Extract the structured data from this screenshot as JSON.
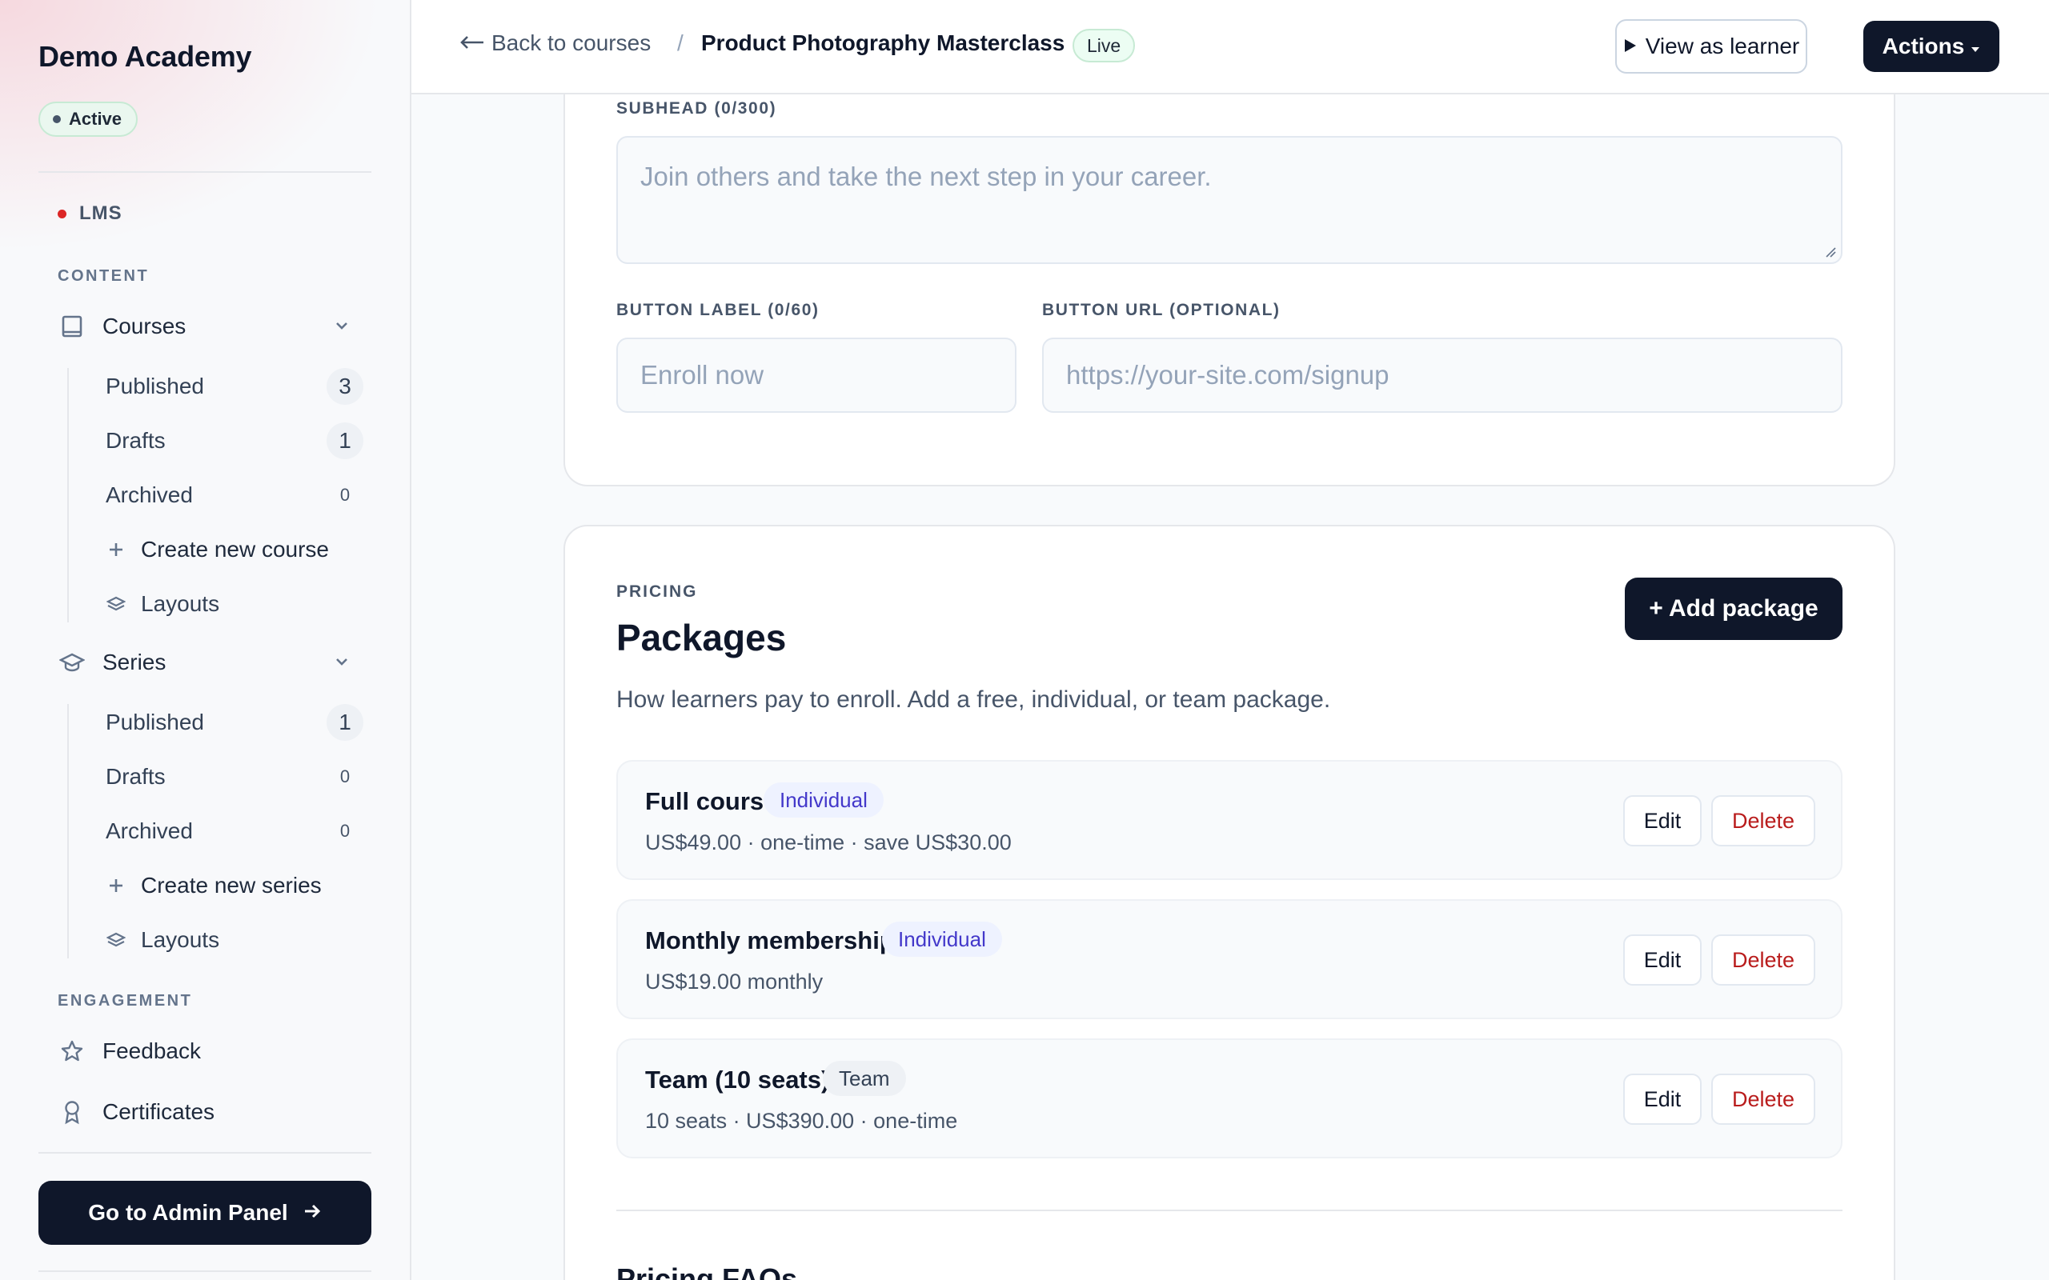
{
  "sidebar": {
    "brand": "Demo Academy",
    "status": "Active",
    "lms_label": "LMS",
    "content_label": "CONTENT",
    "courses": {
      "label": "Courses",
      "items": [
        {
          "label": "Published",
          "count": "3"
        },
        {
          "label": "Drafts",
          "count": "1"
        },
        {
          "label": "Archived",
          "count": "0"
        }
      ],
      "create_label": "Create new course",
      "layouts_label": "Layouts"
    },
    "series": {
      "label": "Series",
      "items": [
        {
          "label": "Published",
          "count": "1"
        },
        {
          "label": "Drafts",
          "count": "0"
        },
        {
          "label": "Archived",
          "count": "0"
        }
      ],
      "create_label": "Create new series",
      "layouts_label": "Layouts"
    },
    "engagement_label": "ENGAGEMENT",
    "engagement_items": [
      {
        "label": "Feedback",
        "icon": "star-icon"
      },
      {
        "label": "Certificates",
        "icon": "award-icon"
      }
    ],
    "admin_button": "Go to Admin Panel"
  },
  "topbar": {
    "back_label": "Back to courses",
    "separator": "/",
    "course_title": "Product Photography Masterclass",
    "status": "Live",
    "view_as_learner": "View as learner",
    "actions": "Actions"
  },
  "cta_form": {
    "subhead_label": "SUBHEAD (0/300)",
    "subhead_placeholder": "Join others and take the next step in your career.",
    "button_label_label": "BUTTON LABEL (0/60)",
    "button_label_placeholder": "Enroll now",
    "button_url_label": "BUTTON URL (OPTIONAL)",
    "button_url_placeholder": "https://your-site.com/signup"
  },
  "pricing": {
    "eyebrow": "PRICING",
    "title": "Packages",
    "description": "How learners pay to enroll. Add a free, individual, or team package.",
    "add_button": "+ Add package",
    "packages": [
      {
        "name": "Full course",
        "tag": "Individual",
        "meta": "US$49.00 · one-time · save US$30.00"
      },
      {
        "name": "Monthly membership",
        "tag": "Individual",
        "meta": "US$19.00 monthly"
      },
      {
        "name": "Team (10 seats)",
        "tag": "Team",
        "meta": "10 seats · US$390.00 · one-time"
      }
    ],
    "edit_label": "Edit",
    "delete_label": "Delete",
    "faq_title": "Pricing FAQs"
  },
  "colors": {
    "primary": "#0f172a",
    "danger": "#b91c1c",
    "individual_tag": "#4338ca",
    "live_dot": "#dc2626"
  }
}
